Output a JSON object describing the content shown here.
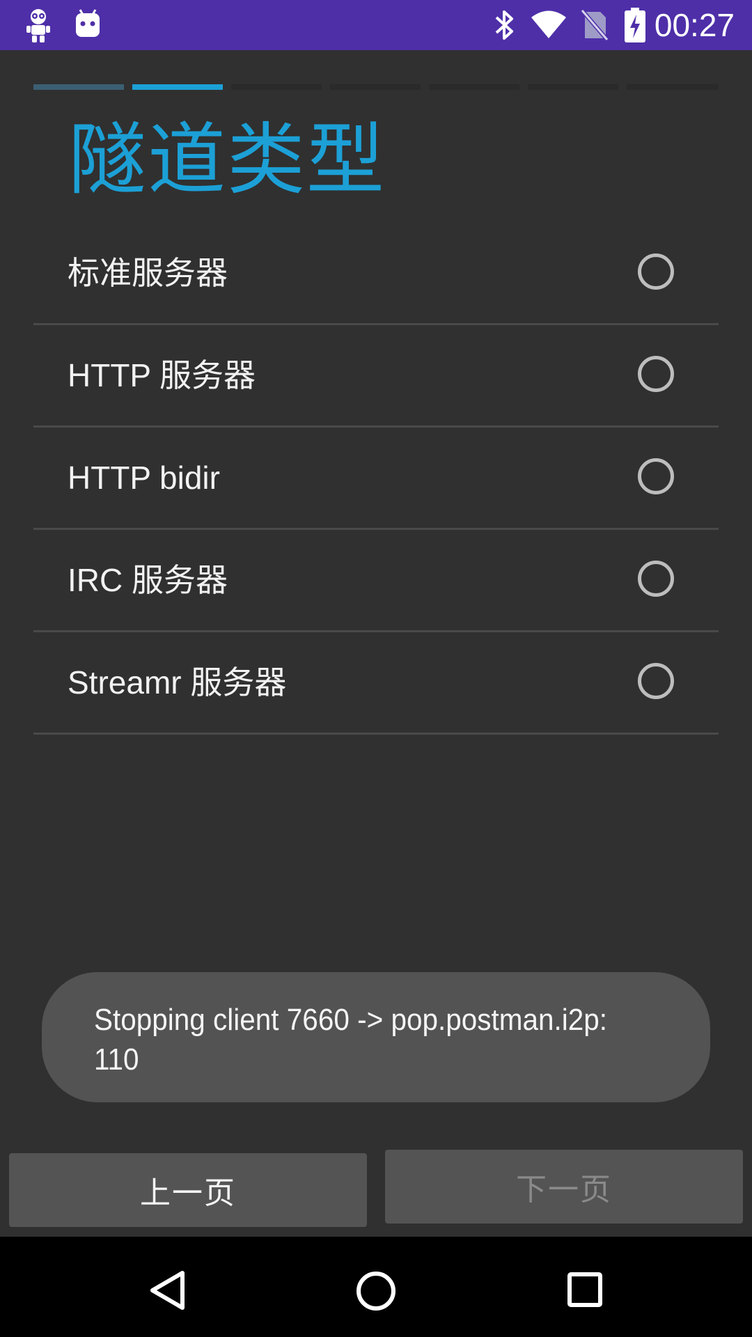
{
  "status_bar": {
    "time": "00:27",
    "left_icons": [
      "app-robot-icon",
      "android-icon"
    ],
    "right_icons": [
      "bluetooth-icon",
      "wifi-icon",
      "no-sim-icon",
      "battery-charging-icon"
    ],
    "background": "#4e2fa8"
  },
  "wizard": {
    "progress": {
      "total_steps": 7,
      "current_step": 2
    },
    "title": "隧道类型",
    "title_color": "#1ca0d6",
    "options": [
      {
        "label": "标准服务器",
        "selected": false
      },
      {
        "label": "HTTP 服务器",
        "selected": false
      },
      {
        "label": "HTTP bidir",
        "selected": false
      },
      {
        "label": "IRC 服务器",
        "selected": false
      },
      {
        "label": "Streamr 服务器",
        "selected": false
      }
    ],
    "prev_label": "上一页",
    "next_label": "下一页",
    "next_enabled": false
  },
  "toast": {
    "text": "Stopping client 7660 -> pop.postman.i2p:\n110"
  },
  "system_nav": [
    "back-icon",
    "home-icon",
    "recents-icon"
  ]
}
